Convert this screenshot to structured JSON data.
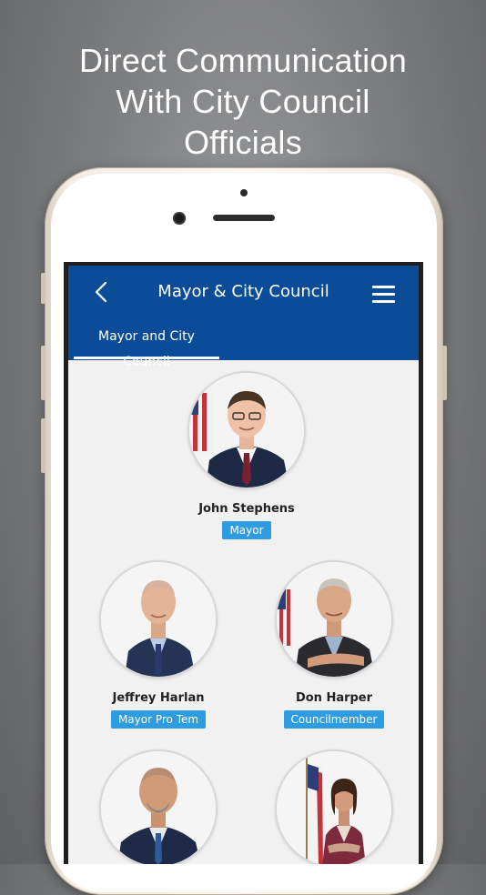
{
  "promo": {
    "headline_line1": "Direct Communication",
    "headline_line2": "With City Council",
    "headline_line3": "Officials"
  },
  "navbar": {
    "back_icon": "chevron-left-icon",
    "title": "Mayor & City Council",
    "menu_icon": "hamburger-menu-icon",
    "color": "#0b4c99"
  },
  "tabs": [
    {
      "label": "Mayor and City Council",
      "active": true
    }
  ],
  "members": [
    {
      "name": "John Stephens",
      "role": "Mayor"
    },
    {
      "name": "Jeffrey Harlan",
      "role": "Mayor Pro Tem"
    },
    {
      "name": "Don Harper",
      "role": "Councilmember"
    },
    {
      "name": "",
      "role": ""
    },
    {
      "name": "",
      "role": ""
    }
  ],
  "colors": {
    "badge": "#2e9ce0",
    "background": "#f1f1f2"
  }
}
